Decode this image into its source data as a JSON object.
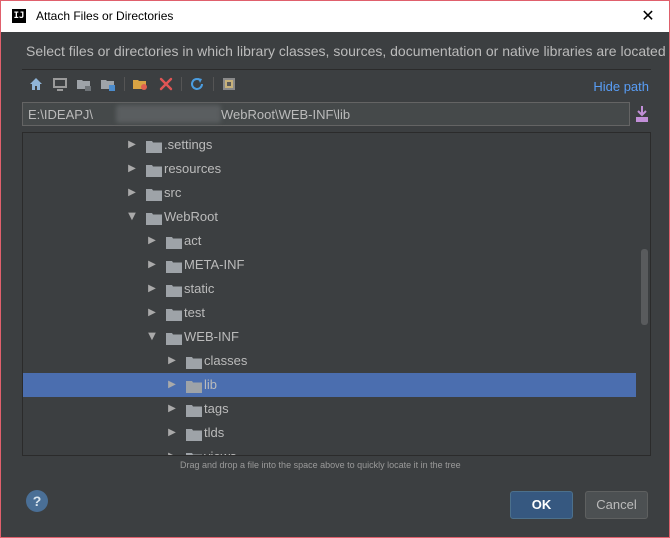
{
  "window": {
    "title": "Attach Files or Directories",
    "app_icon_text": "IJ",
    "close_glyph": "✕"
  },
  "description": "Select files or directories in which library classes, sources, documentation or native libraries are located",
  "toolbar": {
    "icons": [
      "home-icon",
      "desktop-icon",
      "project-folder-icon",
      "module-folder-icon",
      "new-folder-icon",
      "delete-icon",
      "refresh-icon",
      "show-hidden-icon"
    ],
    "hide_path_label": "Hide path"
  },
  "path": {
    "prefix": "E:\\IDEAPJ\\",
    "suffix": "WebRoot\\WEB-INF\\lib"
  },
  "tree": {
    "rows": [
      {
        "label": ".settings",
        "expanded": false,
        "selected": false
      },
      {
        "label": "resources",
        "expanded": false,
        "selected": false
      },
      {
        "label": "src",
        "expanded": false,
        "selected": false
      },
      {
        "label": "WebRoot",
        "expanded": true,
        "selected": false
      },
      {
        "label": "act",
        "expanded": false,
        "selected": false
      },
      {
        "label": "META-INF",
        "expanded": false,
        "selected": false
      },
      {
        "label": "static",
        "expanded": false,
        "selected": false
      },
      {
        "label": "test",
        "expanded": false,
        "selected": false
      },
      {
        "label": "WEB-INF",
        "expanded": true,
        "selected": false
      },
      {
        "label": "classes",
        "expanded": false,
        "selected": false
      },
      {
        "label": "lib",
        "expanded": false,
        "selected": true
      },
      {
        "label": "tags",
        "expanded": false,
        "selected": false
      },
      {
        "label": "tlds",
        "expanded": false,
        "selected": false
      },
      {
        "label": "views",
        "expanded": false,
        "selected": false
      }
    ]
  },
  "hint": "Drag and drop a file into the space above to quickly locate it in the tree",
  "buttons": {
    "help": "?",
    "ok": "OK",
    "cancel": "Cancel"
  },
  "colors": {
    "background": "#3c3f41",
    "selection": "#4b6eaf",
    "link": "#589df6",
    "ok_button": "#365880",
    "border_accent": "#e0606c"
  }
}
